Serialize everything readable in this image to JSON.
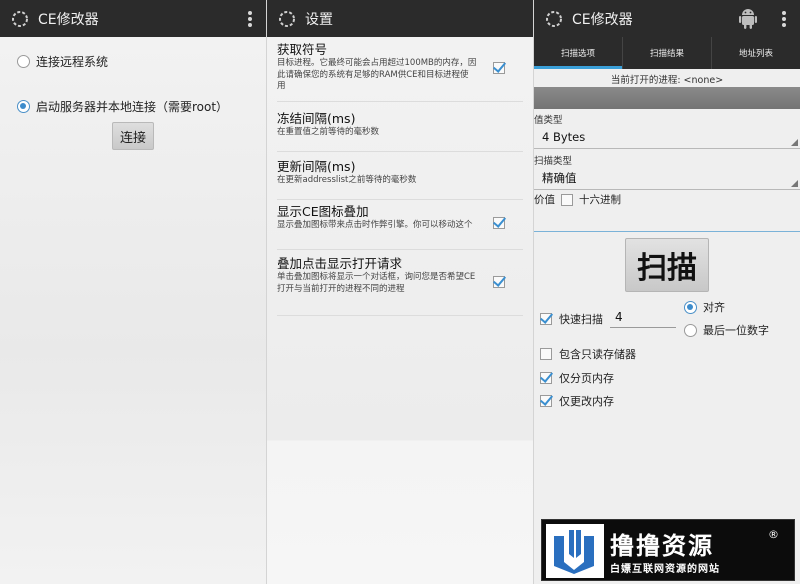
{
  "panel1": {
    "title": "CE修改器",
    "options": [
      {
        "label": "连接远程系统",
        "selected": false
      },
      {
        "label": "启动服务器并本地连接（需要root）",
        "selected": true
      }
    ],
    "connect_button": "连接"
  },
  "panel2": {
    "title": "设置",
    "settings": [
      {
        "title": "获取符号",
        "desc": "目标进程。它最终可能会占用超过100MB的内存，因此请确保您的系统有足够的RAM供CE和目标进程使用",
        "checked": true
      },
      {
        "title": "冻结间隔(ms)",
        "desc": "在重置值之前等待的毫秒数"
      },
      {
        "title": "更新间隔(ms)",
        "desc": "在更新addresslist之前等待的毫秒数"
      },
      {
        "title": "显示CE图标叠加",
        "desc": "显示叠加图标带来点击时作弊引擎。你可以移动这个",
        "checked": true
      },
      {
        "title": "叠加点击显示打开请求",
        "desc": "单击叠加图标将显示一个对话框，询问您是否希望CE打开与当前打开的进程不同的进程",
        "checked": true
      }
    ]
  },
  "panel3": {
    "title": "CE修改器",
    "tabs": [
      "扫描选项",
      "扫描结果",
      "地址列表"
    ],
    "active_tab": "扫描选项",
    "current_process": "当前打开的进程: <none>",
    "value_type_label": "值类型",
    "value_type": "4 Bytes",
    "scan_type_label": "扫描类型",
    "scan_type": "精确值",
    "value_label": "价值",
    "hex_label": "十六进制",
    "hex_checked": false,
    "value_input": "",
    "scan_button": "扫描",
    "fast_scan_label": "快速扫描",
    "fast_scan_checked": true,
    "fast_scan_value": "4",
    "align_options": [
      {
        "label": "对齐",
        "selected": true
      },
      {
        "label": "最后一位数字",
        "selected": false
      }
    ],
    "checkboxes": [
      {
        "label": "包含只读存储器",
        "checked": false
      },
      {
        "label": "仅分页内存",
        "checked": true
      },
      {
        "label": "仅更改内存",
        "checked": true
      }
    ]
  },
  "watermark": {
    "title": "撸撸资源",
    "registered": "®",
    "subtitle": "白嫖互联网资源的网站"
  },
  "colors": {
    "actionbar": "#2b2b2b",
    "accent": "#3a9fd8",
    "watermark_blue": "#2a6fbf"
  }
}
